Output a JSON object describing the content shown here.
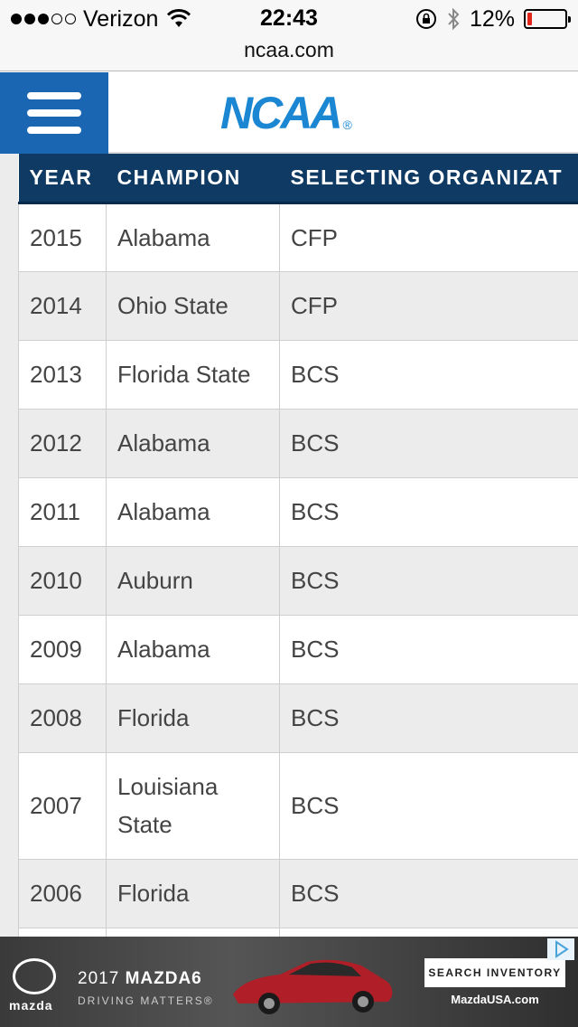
{
  "status_bar": {
    "carrier": "Verizon",
    "time": "22:43",
    "battery_percent": "12%",
    "battery_level": 0.12,
    "battery_color": "#e3261a",
    "signal_bars_filled": 3,
    "signal_bars_total": 5
  },
  "browser": {
    "url": "ncaa.com"
  },
  "header": {
    "logo_text": "NCAA",
    "logo_reg": "®",
    "brand_color": "#1b87d3",
    "menu_color": "#1a66b2"
  },
  "table": {
    "header_color": "#0f3a63",
    "columns": [
      "YEAR",
      "CHAMPION",
      "SELECTING ORGANIZAT"
    ],
    "rows": [
      {
        "year": "2015",
        "champion": "Alabama",
        "org": "CFP"
      },
      {
        "year": "2014",
        "champion": "Ohio State",
        "org": "CFP"
      },
      {
        "year": "2013",
        "champion": "Florida State",
        "org": "BCS"
      },
      {
        "year": "2012",
        "champion": "Alabama",
        "org": "BCS"
      },
      {
        "year": "2011",
        "champion": "Alabama",
        "org": "BCS"
      },
      {
        "year": "2010",
        "champion": "Auburn",
        "org": "BCS"
      },
      {
        "year": "2009",
        "champion": "Alabama",
        "org": "BCS"
      },
      {
        "year": "2008",
        "champion": "Florida",
        "org": "BCS"
      },
      {
        "year": "2007",
        "champion": "Louisiana State",
        "org": "BCS"
      },
      {
        "year": "2006",
        "champion": "Florida",
        "org": "BCS"
      },
      {
        "year": "",
        "champion": "",
        "org": ""
      }
    ]
  },
  "ad": {
    "brand": "mazda",
    "year": "2017",
    "model": "MAZDA6",
    "tagline": "DRIVING MATTERS®",
    "cta": "SEARCH INVENTORY",
    "url": "MazdaUSA.com",
    "car_color": "#b01e28"
  }
}
